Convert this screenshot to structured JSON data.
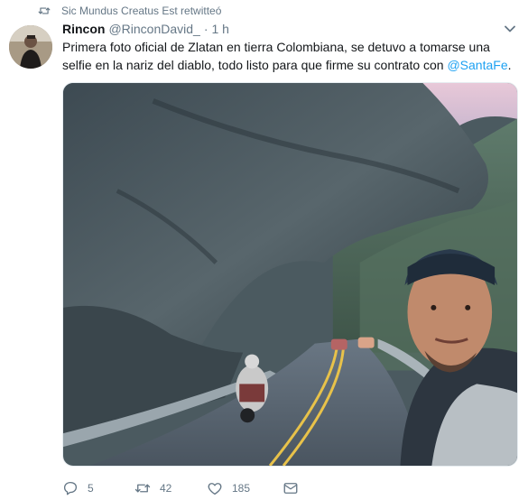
{
  "retweet_notice": {
    "text": "Sic Mundus Creatus Est retwitteó",
    "icon": "retweet-icon"
  },
  "tweet": {
    "author_name": "Rincon",
    "author_handle": "@RinconDavid_",
    "separator": "·",
    "time": "1 h",
    "text_before_mention": "Primera foto oficial de Zlatan en tierra Colombiana, se detuvo a tomarse una selfie en la nariz del diablo, todo listo para que firme su contrato con ",
    "mention": "@SantaFe",
    "text_after_mention": ".",
    "media_description_icon": "photo"
  },
  "actions": {
    "reply_count": "5",
    "retweet_count": "42",
    "like_count": "185",
    "message_icon": "envelope-icon"
  },
  "colors": {
    "text": "#14171a",
    "secondary": "#657786",
    "link": "#1da1f2"
  }
}
